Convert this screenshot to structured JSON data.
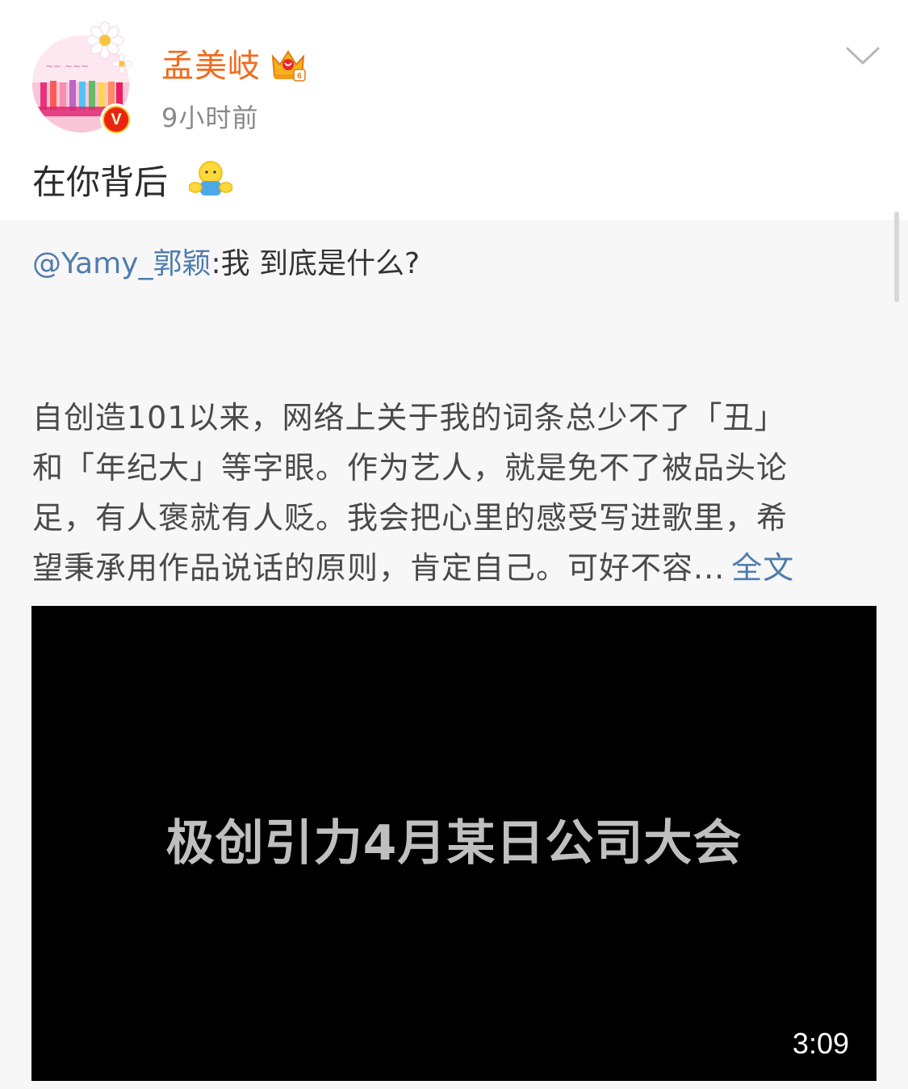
{
  "author": {
    "name": "孟美岐",
    "avatar_icon": "avatar-image",
    "verified_badge": "V",
    "crown_icon": "crown-vip-icon"
  },
  "post": {
    "timestamp": "9小时前",
    "text": "在你背后",
    "emoji": "hug-emoji"
  },
  "menu_icon": "chevron-down-icon",
  "quote": {
    "mention": "@Yamy_郭颖",
    "mention_text": ":我 到底是什么?",
    "body_lines": [
      "自创造101以来，网络上关于我的词条总少不了「丑」",
      "和「年纪大」等字眼。作为艺人，就是免不了被品头论",
      "足，有人褒就有人贬。我会把心里的感受写进歌里，希",
      "望秉承用作品说话的原则，肯定自己。可好不容..."
    ],
    "full_text_label": "全文"
  },
  "video": {
    "title": "极创引力4月某日公司大会",
    "duration": "3:09"
  },
  "colors": {
    "name": "#f26a1b",
    "link": "#4f7cad",
    "quote_bg": "#f7f7f7",
    "video_bg": "#000000"
  }
}
